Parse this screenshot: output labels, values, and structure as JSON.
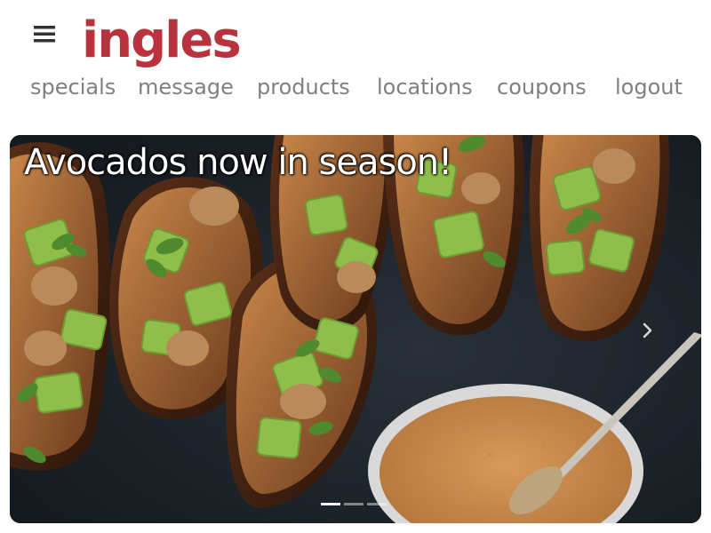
{
  "brand": {
    "logo_text": "ingles",
    "color": "#b8333d"
  },
  "colors": {
    "nav_text": "#808080",
    "menu_icon": "#333333"
  },
  "icons": {
    "menu": "hamburger-menu-icon",
    "next": "chevron-right-icon"
  },
  "nav": {
    "items": [
      {
        "label": "specials"
      },
      {
        "label": "message"
      },
      {
        "label": "products"
      },
      {
        "label": "locations"
      },
      {
        "label": "coupons"
      },
      {
        "label": "logout"
      }
    ]
  },
  "carousel": {
    "caption": "Avocados now in season!",
    "slide_count": 3,
    "active_index": 0
  }
}
